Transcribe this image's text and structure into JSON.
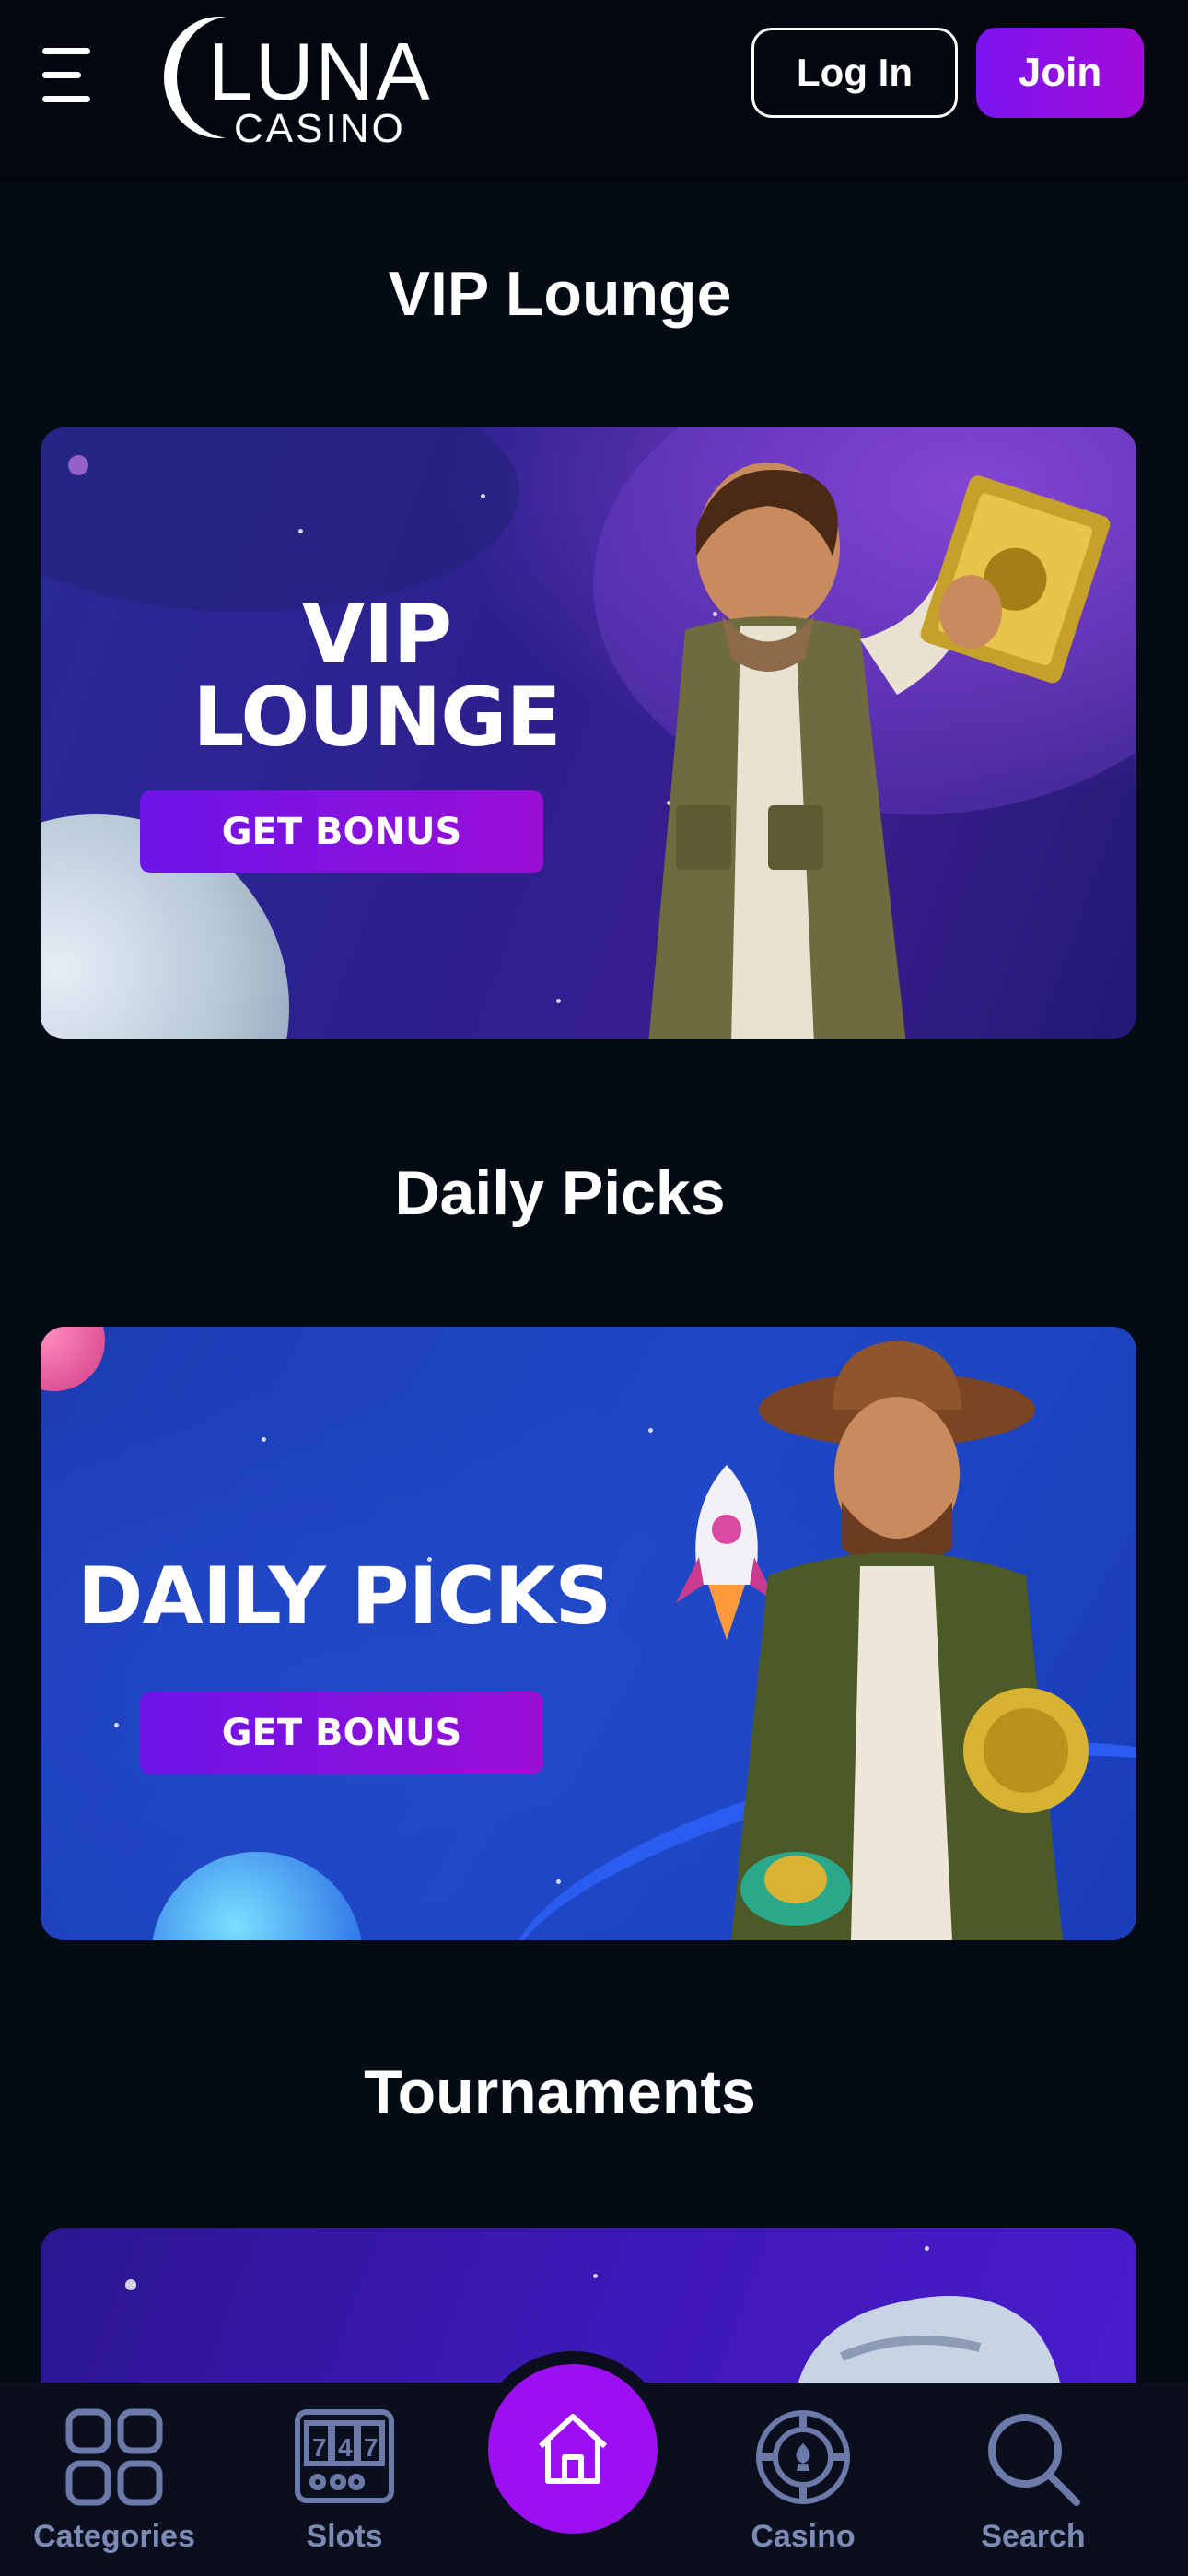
{
  "header": {
    "logo": {
      "word": "LUNA",
      "sub": "CASINO"
    },
    "login_label": "Log In",
    "join_label": "Join"
  },
  "sections": [
    {
      "title": "VIP Lounge",
      "banner": {
        "heading_line1": "VIP",
        "heading_line2": "LOUNGE",
        "button": "GET BONUS"
      }
    },
    {
      "title": "Daily Picks",
      "banner": {
        "heading": "DAILY PICKS",
        "button": "GET BONUS"
      }
    },
    {
      "title": "Tournaments"
    }
  ],
  "bottom_nav": {
    "items": [
      {
        "label": "Categories",
        "icon": "grid-icon"
      },
      {
        "label": "Slots",
        "icon": "slot-machine-icon"
      },
      {
        "label": "",
        "icon": "home-icon"
      },
      {
        "label": "Casino",
        "icon": "poker-chip-icon"
      },
      {
        "label": "Search",
        "icon": "search-icon"
      }
    ]
  },
  "colors": {
    "background": "#050b15",
    "accent_purple": "#9b0ff0",
    "nav_label": "#7c8bb5"
  }
}
